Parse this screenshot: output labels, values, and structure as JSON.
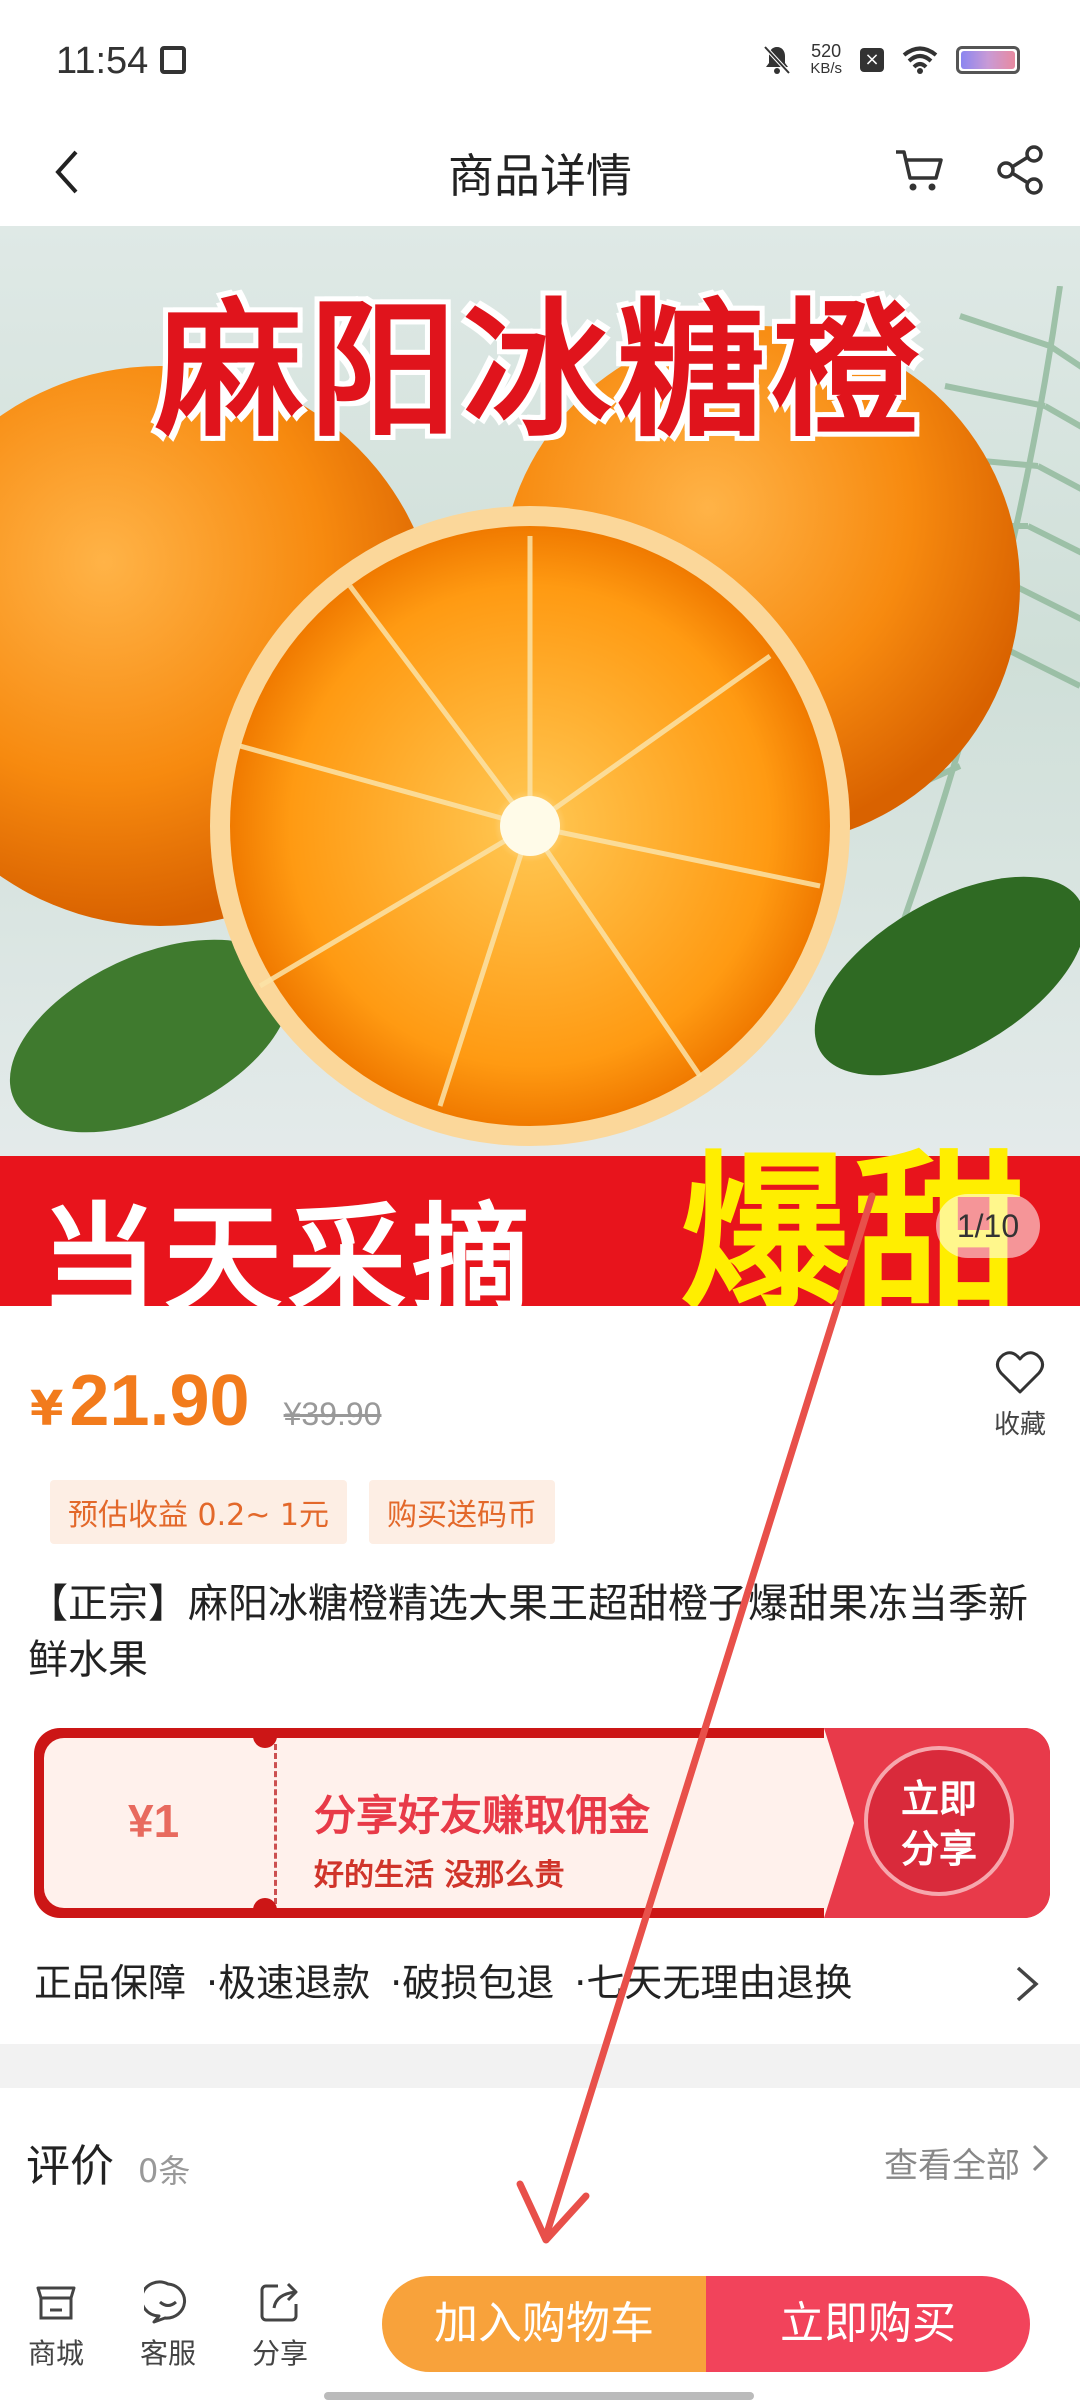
{
  "status_bar": {
    "time": "11:54",
    "netspeed_value": "520",
    "netspeed_unit": "KB/s"
  },
  "header": {
    "title": "商品详情"
  },
  "hero": {
    "top_title": "麻阳冰糖橙",
    "banner_left": "当天采摘",
    "banner_right": "爆甜",
    "counter": "1/10"
  },
  "price": {
    "symbol": "¥",
    "current": "21.90",
    "original": "¥39.90",
    "favorite_label": "收藏"
  },
  "tags": [
    "预估收益 0.2~ 1元",
    "购买送码币"
  ],
  "product_title": "【正宗】麻阳冰糖橙精选大果王超甜橙子爆甜果冻当季新鲜水果",
  "share_card": {
    "amount": "¥1",
    "main": "分享好友赚取佣金",
    "sub": "好的生活 没那么贵",
    "button_line1": "立即",
    "button_line2": "分享"
  },
  "guarantees": [
    "正品保障",
    "极速退款",
    "破损包退",
    "七天无理由退换"
  ],
  "review": {
    "title": "评价",
    "count": "0条",
    "view_all": "查看全部"
  },
  "bottom_bar": {
    "shop": "商城",
    "service": "客服",
    "share": "分享",
    "add_cart": "加入购物车",
    "buy_now": "立即购买"
  },
  "colors": {
    "price": "#f27b1c",
    "add_cart": "#f8a23b",
    "buy_now": "#f2435b",
    "banner_red": "#e8141c",
    "annotation_arrow": "#e8504a"
  }
}
